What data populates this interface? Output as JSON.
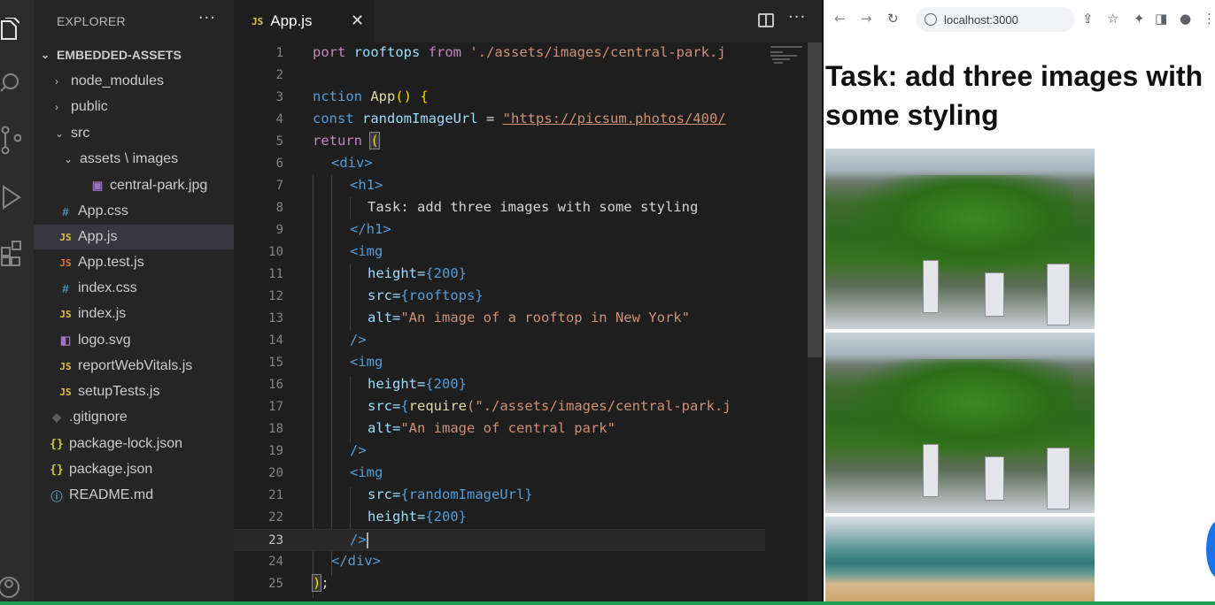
{
  "explorer": {
    "header": "EXPLORER",
    "more": "···",
    "root": "EMBEDDED-ASSETS",
    "items": [
      {
        "label": "node_modules"
      },
      {
        "label": "public"
      },
      {
        "label": "src"
      },
      {
        "label": "assets \\ images"
      },
      {
        "label": "central-park.jpg"
      },
      {
        "label": "App.css"
      },
      {
        "label": "App.js"
      },
      {
        "label": "App.test.js"
      },
      {
        "label": "index.css"
      },
      {
        "label": "index.js"
      },
      {
        "label": "logo.svg"
      },
      {
        "label": "reportWebVitals.js"
      },
      {
        "label": "setupTests.js"
      },
      {
        "label": ".gitignore"
      },
      {
        "label": "package-lock.json"
      },
      {
        "label": "package.json"
      },
      {
        "label": "README.md"
      }
    ]
  },
  "editor": {
    "tab_icon": "JS",
    "tab_name": "App.js",
    "tab_close": "✕",
    "more": "···",
    "line_numbers": [
      "1",
      "2",
      "3",
      "4",
      "5",
      "6",
      "7",
      "8",
      "9",
      "10",
      "11",
      "12",
      "13",
      "14",
      "15",
      "16",
      "17",
      "18",
      "19",
      "20",
      "21",
      "22",
      "23",
      "24",
      "25"
    ],
    "code": {
      "l1_kw": "port",
      "l1_var": "rooftops",
      "l1_from": "from",
      "l1_str": "'./assets/images/central-park.j",
      "l3_kw": "nction",
      "l3_fn": "App",
      "l3_rest": "() {",
      "l4_kw": "const",
      "l4_var": "randomImageUrl",
      "l4_eq": " = ",
      "l4_url": "\"https://picsum.photos/400/",
      "l5_kw": "return",
      "l5_paren": "(",
      "l6_tag": "<div>",
      "l7_tag": "<h1>",
      "l8_txt": "Task: add three images with some styling",
      "l9_tag": "</h1>",
      "l10_tag": "<img",
      "l11_attr": "height=",
      "l11_val": "{200}",
      "l12_attr": "src=",
      "l12_val": "{rooftops}",
      "l13_attr": "alt=",
      "l13_val": "\"An image of a rooftop in New York\"",
      "l14_tag": "/>",
      "l15_tag": "<img",
      "l16_attr": "height=",
      "l16_val": "{200}",
      "l17_attr": "src=",
      "l17_open": "{",
      "l17_fn": "require",
      "l17_str": "(\"./assets/images/central-park.j",
      "l18_attr": "alt=",
      "l18_val": "\"An image of central park\"",
      "l19_tag": "/>",
      "l20_tag": "<img",
      "l21_attr": "src=",
      "l21_val": "{randomImageUrl}",
      "l22_attr": "height=",
      "l22_val": "{200}",
      "l23_tag": "/>",
      "l24_tag": "</div>",
      "l25_paren": ")",
      "l25_semi": ";"
    }
  },
  "browser": {
    "back": "←",
    "forward": "→",
    "reload": "↻",
    "url": "localhost:3000",
    "heading": "Task: add three images with some styling"
  },
  "colors": {
    "accent_js": "#e8c04a",
    "accent_blue": "#1a73e8",
    "status_green": "#1f9d55"
  }
}
